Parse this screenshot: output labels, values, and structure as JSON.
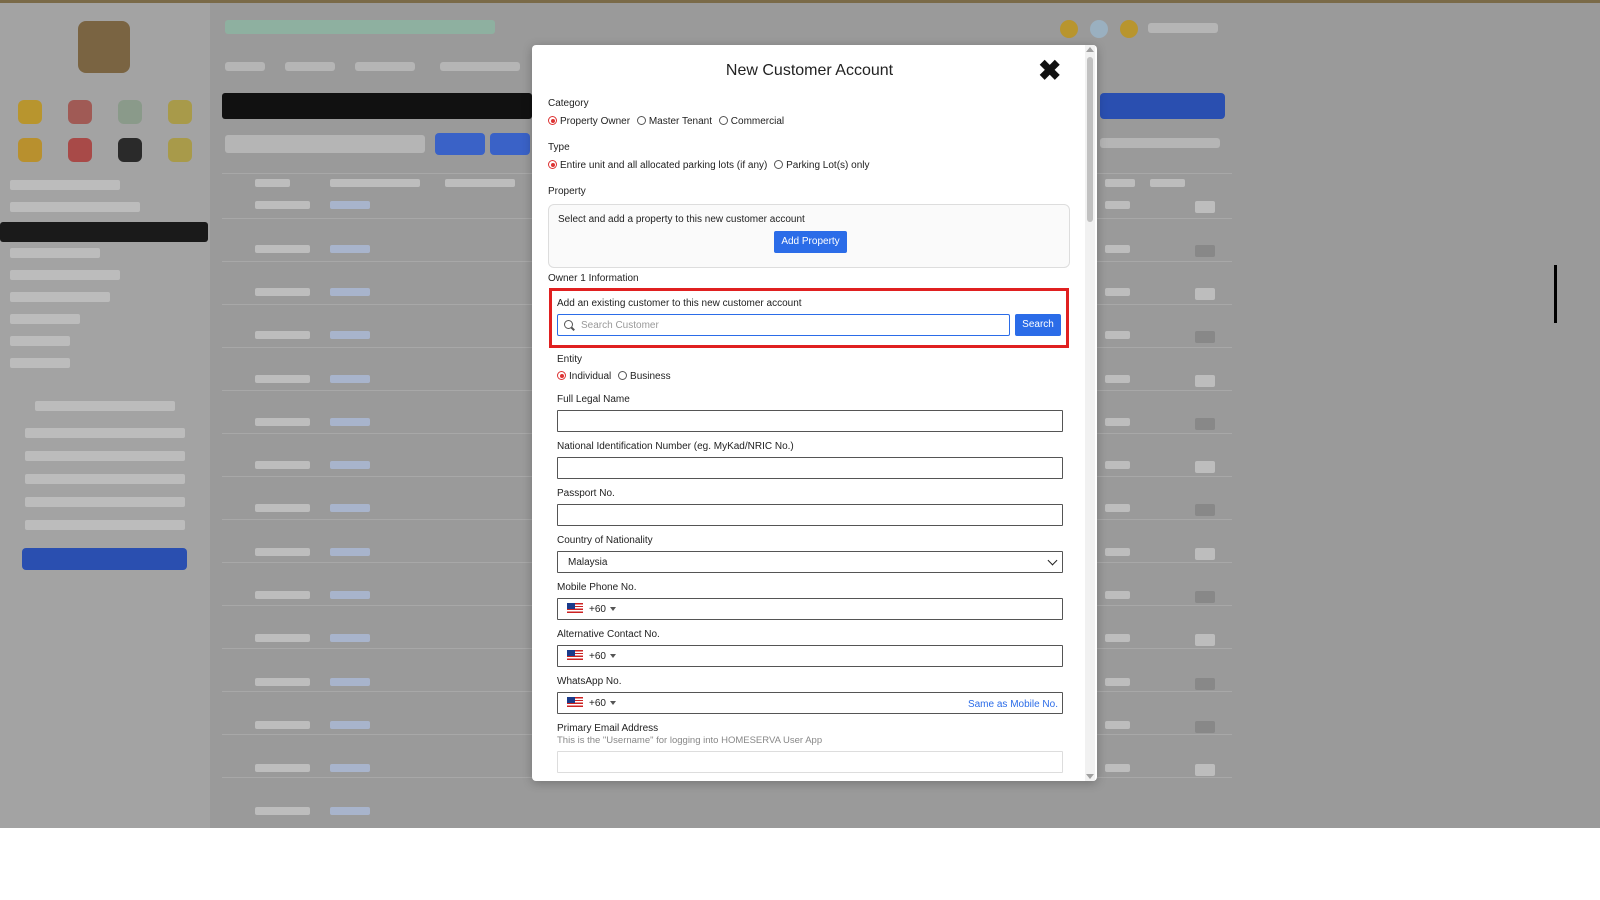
{
  "modal": {
    "title": "New Customer Account",
    "close_label": "✖",
    "category": {
      "label": "Category",
      "options": [
        "Property Owner",
        "Master Tenant",
        "Commercial"
      ],
      "selected": "Property Owner"
    },
    "type": {
      "label": "Type",
      "options": [
        "Entire unit and all allocated parking lots (if any)",
        "Parking Lot(s) only"
      ],
      "selected": "Entire unit and all allocated parking lots (if any)"
    },
    "property": {
      "label": "Property",
      "description": "Select and add a property to this new customer account",
      "button": "Add Property"
    },
    "owner": {
      "section_label": "Owner 1 Information",
      "existing_label": "Add an existing customer to this new customer account",
      "search_placeholder": "Search Customer",
      "search_button": "Search",
      "entity_label": "Entity",
      "entity_options": [
        "Individual",
        "Business"
      ],
      "entity_selected": "Individual",
      "full_name_label": "Full Legal Name",
      "full_name_value": "",
      "nric_label": "National Identification Number (eg. MyKad/NRIC No.)",
      "nric_value": "",
      "passport_label": "Passport No.",
      "passport_value": "",
      "nationality_label": "Country of Nationality",
      "nationality_value": "Malaysia",
      "mobile_label": "Mobile Phone No.",
      "mobile_code": "+60",
      "alt_label": "Alternative Contact No.",
      "alt_code": "+60",
      "whatsapp_label": "WhatsApp No.",
      "whatsapp_code": "+60",
      "same_as_mobile": "Same as Mobile No.",
      "email_label": "Primary Email Address",
      "email_hint": "This is the \"Username\" for logging into HOMESERVA User App"
    }
  },
  "colors": {
    "accent": "#2b6ce8",
    "highlight": "#e02020",
    "radio_on": "#dd3333"
  }
}
